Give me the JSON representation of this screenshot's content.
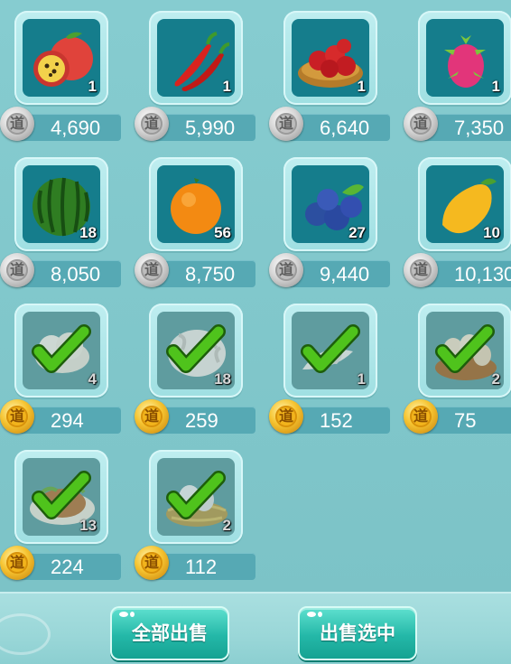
{
  "items": [
    {
      "id": "passion-fruit",
      "icon": "passion-fruit-icon",
      "qty": "1",
      "price": "4,690",
      "coin": "silver",
      "sold": false
    },
    {
      "id": "chili",
      "icon": "chili-pepper-icon",
      "qty": "1",
      "price": "5,990",
      "coin": "silver",
      "sold": false
    },
    {
      "id": "rambutan",
      "icon": "rambutan-icon",
      "qty": "1",
      "price": "6,640",
      "coin": "silver",
      "sold": false
    },
    {
      "id": "dragon-fruit",
      "icon": "dragon-fruit-icon",
      "qty": "1",
      "price": "7,350",
      "coin": "silver",
      "sold": false
    },
    {
      "id": "watermelon",
      "icon": "watermelon-icon",
      "qty": "18",
      "price": "8,050",
      "coin": "silver",
      "sold": false
    },
    {
      "id": "orange",
      "icon": "orange-icon",
      "qty": "56",
      "price": "8,750",
      "coin": "silver",
      "sold": false
    },
    {
      "id": "blueberry",
      "icon": "blueberry-icon",
      "qty": "27",
      "price": "9,440",
      "coin": "silver",
      "sold": false
    },
    {
      "id": "mango",
      "icon": "mango-icon",
      "qty": "10",
      "price": "10,130",
      "coin": "silver",
      "sold": false
    },
    {
      "id": "cotton",
      "icon": "cotton-icon",
      "qty": "4",
      "price": "294",
      "coin": "gold",
      "sold": true
    },
    {
      "id": "wool",
      "icon": "wool-icon",
      "qty": "18",
      "price": "259",
      "coin": "gold",
      "sold": true
    },
    {
      "id": "feathers",
      "icon": "feathers-icon",
      "qty": "1",
      "price": "152",
      "coin": "gold",
      "sold": true
    },
    {
      "id": "eggs",
      "icon": "egg-basket-icon",
      "qty": "2",
      "price": "75",
      "coin": "gold",
      "sold": true
    },
    {
      "id": "dish",
      "icon": "roast-dish-icon",
      "qty": "13",
      "price": "224",
      "coin": "gold",
      "sold": true
    },
    {
      "id": "nest-eggs",
      "icon": "nest-eggs-icon",
      "qty": "2",
      "price": "112",
      "coin": "gold",
      "sold": true
    }
  ],
  "coin_glyph": "道",
  "buttons": {
    "sell_all": "全部出售",
    "sell_selected": "出售选中"
  },
  "colors": {
    "tile_bg": "#157d8c",
    "sold_tile_bg": "#5f9c9f",
    "price_bar": "#56a9b4",
    "check": "#4fc31c"
  }
}
